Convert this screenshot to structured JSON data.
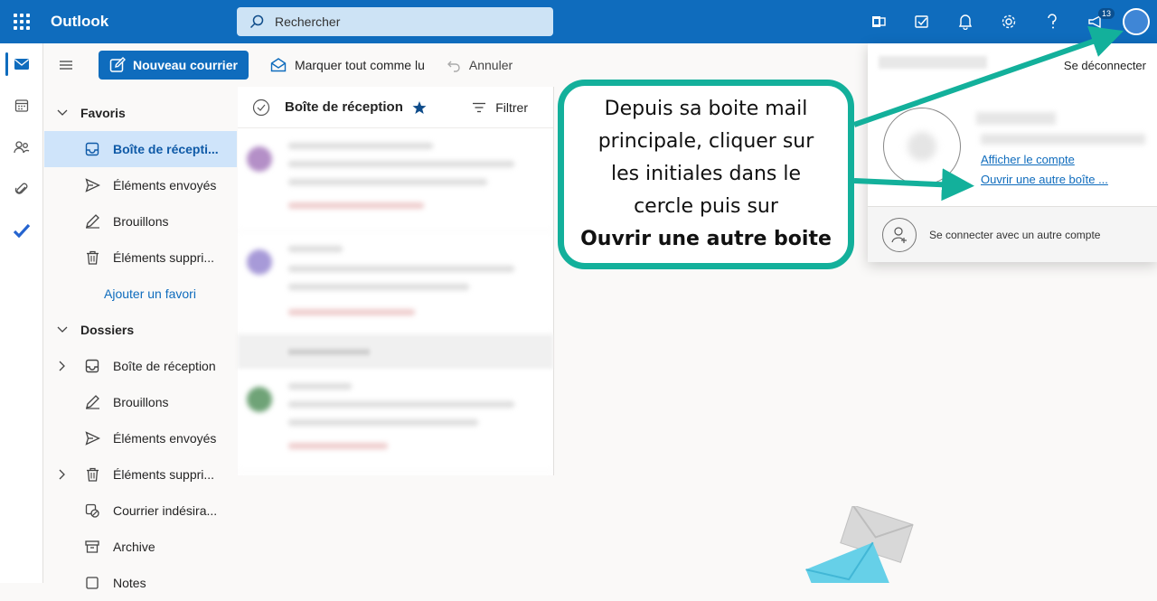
{
  "header": {
    "app_name": "Outlook",
    "search_placeholder": "Rechercher",
    "notification_count": "13"
  },
  "command_bar": {
    "new_mail": "Nouveau courrier",
    "mark_all_read": "Marquer tout comme lu",
    "undo": "Annuler"
  },
  "folders": {
    "favorites_label": "Favoris",
    "favorites": [
      {
        "label": "Boîte de récepti..."
      },
      {
        "label": "Éléments envoyés"
      },
      {
        "label": "Brouillons"
      },
      {
        "label": "Éléments suppri..."
      }
    ],
    "add_favorite": "Ajouter un favori",
    "folders_label": "Dossiers",
    "items": [
      {
        "label": "Boîte de réception"
      },
      {
        "label": "Brouillons"
      },
      {
        "label": "Éléments envoyés"
      },
      {
        "label": "Éléments suppri..."
      },
      {
        "label": "Courrier indésira..."
      },
      {
        "label": "Archive"
      },
      {
        "label": "Notes"
      }
    ]
  },
  "message_list": {
    "title": "Boîte de réception",
    "filter": "Filtrer"
  },
  "account_panel": {
    "sign_out": "Se déconnecter",
    "view_account": "Afficher le compte",
    "open_other_mailbox": "Ouvrir une autre boîte ...",
    "sign_in_other": "Se connecter avec un autre compte"
  },
  "callout": {
    "lines": [
      "Depuis sa boite mail",
      "principale, cliquer sur",
      "les initiales dans le",
      "cercle puis sur"
    ],
    "bold_line": "Ouvrir une autre boite"
  },
  "colors": {
    "brand": "#0f6cbd",
    "callout_border": "#13b09b"
  }
}
